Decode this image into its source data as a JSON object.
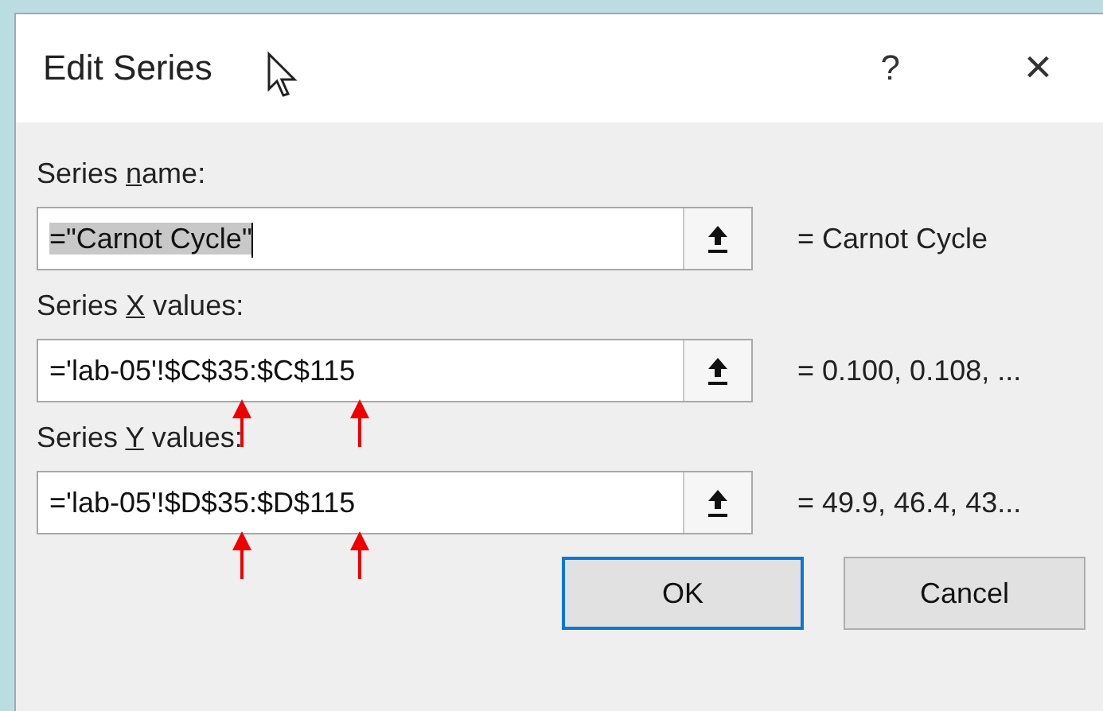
{
  "window": {
    "title": "Edit Series",
    "help": "?",
    "close": "×"
  },
  "fields": [
    {
      "label": {
        "before": "Series ",
        "key": "n",
        "after": "ame:"
      },
      "value": "=\"Carnot Cycle\"",
      "text_selected": true,
      "arrows": false,
      "preview": "= Carnot Cycle"
    },
    {
      "label": {
        "before": "Series ",
        "key": "X",
        "after": " values:"
      },
      "value": "='lab-05'!$C$35:$C$115",
      "text_selected": false,
      "arrows": true,
      "preview": "= 0.100, 0.108, ..."
    },
    {
      "label": {
        "before": "Series ",
        "key": "Y",
        "after": " values:"
      },
      "value": "='lab-05'!$D$35:$D$115",
      "text_selected": false,
      "arrows": true,
      "preview": "= 49.9, 46.4, 43..."
    }
  ],
  "buttons": [
    {
      "label": "OK",
      "default": true
    },
    {
      "label": "Cancel",
      "default": false
    }
  ]
}
